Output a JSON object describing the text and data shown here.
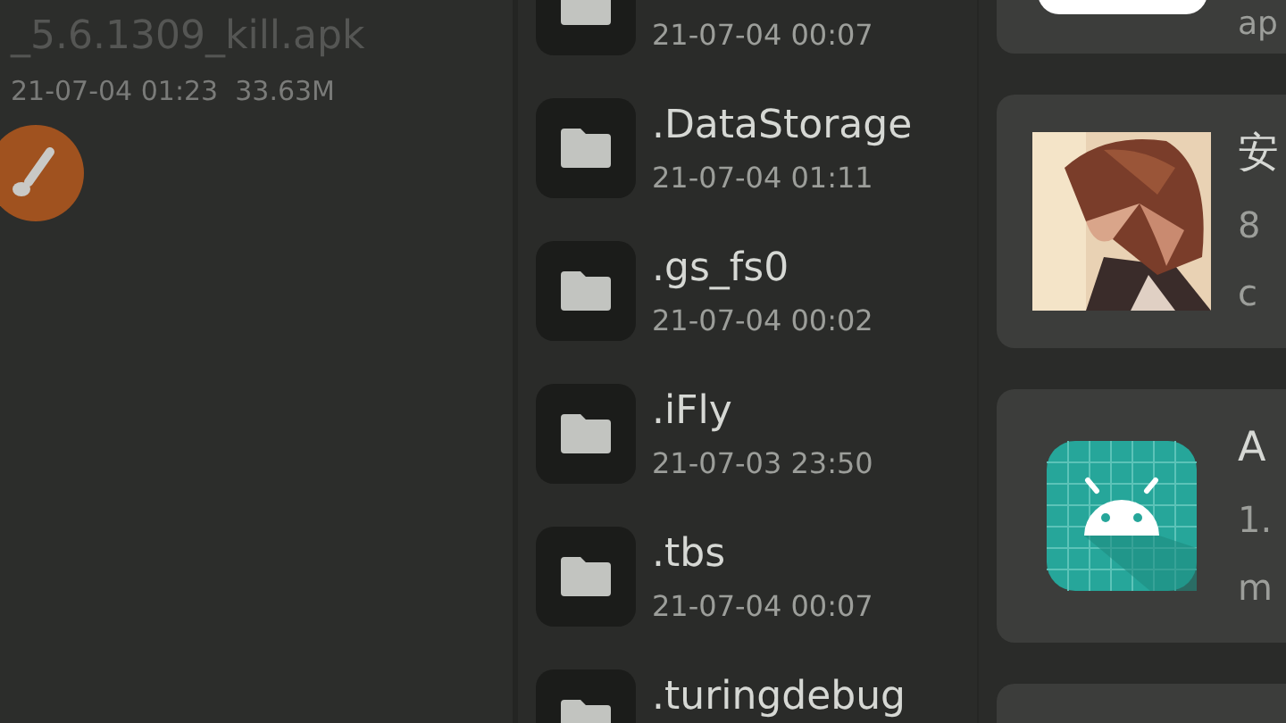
{
  "left_pane": {
    "file_name": "_5.6.1309_kill.apk",
    "file_info": "21-07-04 01:23  33.63M"
  },
  "folders": [
    {
      "date": "21-07-04 00:07"
    },
    {
      "name": ".DataStorage",
      "date": "21-07-04 01:11"
    },
    {
      "name": ".gs_fs0",
      "date": "21-07-04 00:02"
    },
    {
      "name": ".iFly",
      "date": "21-07-03 23:50"
    },
    {
      "name": ".tbs",
      "date": "21-07-04 00:07"
    },
    {
      "name": ".turingdebug"
    }
  ],
  "cards": [
    {
      "kind": "button",
      "texts": [
        "ap"
      ]
    },
    {
      "kind": "picture",
      "texts": [
        "安",
        "8",
        "c"
      ]
    },
    {
      "kind": "app",
      "texts": [
        "A",
        "1.",
        "m"
      ]
    },
    {
      "kind": "empty"
    }
  ]
}
